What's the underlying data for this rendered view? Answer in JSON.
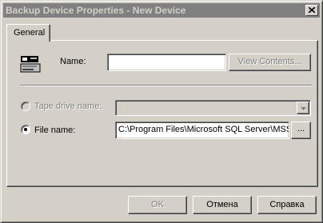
{
  "window": {
    "title": "Backup Device Properties - New Device"
  },
  "tabs": [
    {
      "label": "General"
    }
  ],
  "form": {
    "name_label": "Name:",
    "name_value": "",
    "view_contents_label": "View Contents...",
    "tape_drive_label": "Tape drive name:",
    "tape_drive_value": "",
    "file_name_label": "File name:",
    "file_name_value": "C:\\Program Files\\Microsoft SQL Server\\MSS",
    "browse_label": "...",
    "selected_destination": "File name"
  },
  "buttons": {
    "ok": "OK",
    "cancel": "Отмена",
    "help": "Справка"
  },
  "colors": {
    "face": "#d4d0c8",
    "titlebar_inactive": "#808080",
    "disabled_text": "#808080"
  }
}
